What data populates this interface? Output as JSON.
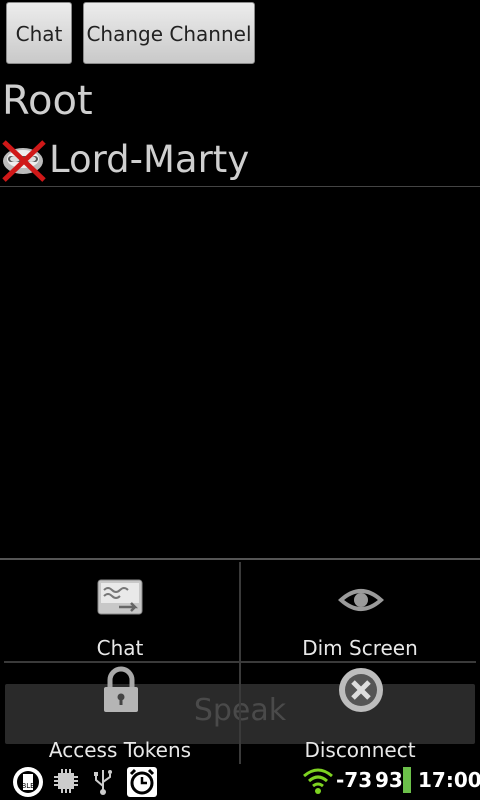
{
  "toolbar": {
    "chat_label": "Chat",
    "change_channel_label": "Change Channel"
  },
  "channel": {
    "name": "Root",
    "users": [
      {
        "name": "Lord-Marty",
        "icon": "muted-deafened-icon"
      }
    ]
  },
  "menu": {
    "items": [
      {
        "label": "Chat",
        "icon": "chat-icon"
      },
      {
        "label": "Dim Screen",
        "icon": "eye-icon"
      },
      {
        "label": "Access Tokens",
        "icon": "lock-icon"
      },
      {
        "label": "Disconnect",
        "icon": "close-circle-icon"
      }
    ],
    "speak_label": "Speak"
  },
  "statusbar": {
    "wifi_signal": "-73",
    "battery_level": "93",
    "time": "17:00"
  },
  "colors": {
    "background": "#000000",
    "button": "#dcdcdc",
    "text": "#d8d8d8",
    "battery": "#6cc04a",
    "wifi": "#7ed321"
  }
}
